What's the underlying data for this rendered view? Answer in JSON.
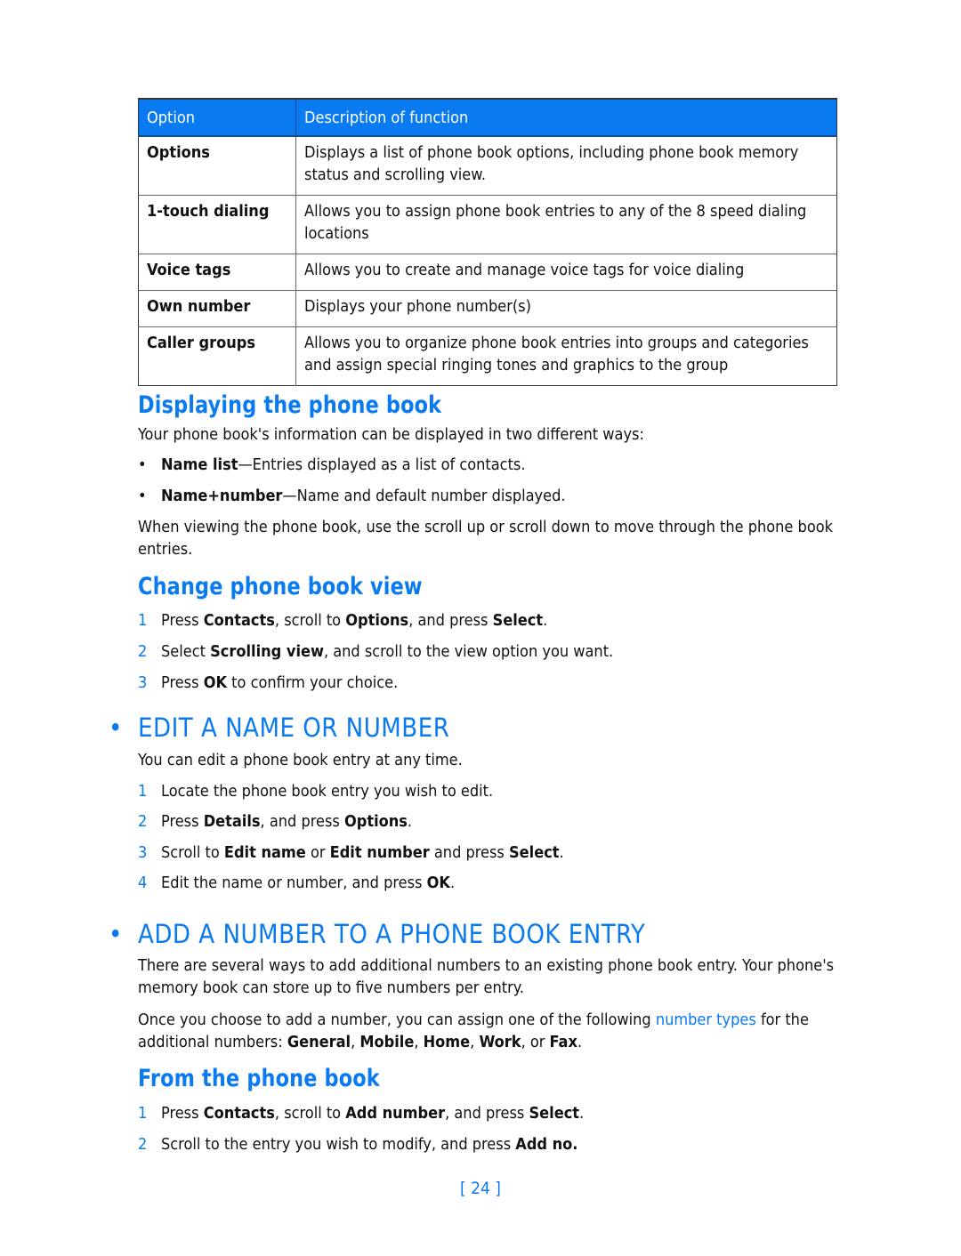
{
  "table": {
    "headers": [
      "Option",
      "Description of function"
    ],
    "rows": [
      {
        "option": "Options",
        "description": "Displays a list of phone book options, including phone book memory status and scrolling view."
      },
      {
        "option": "1-touch dialing",
        "description": "Allows you to assign phone book entries to any of the 8 speed dialing locations"
      },
      {
        "option": "Voice tags",
        "description": "Allows you to create and manage voice tags for voice dialing"
      },
      {
        "option": "Own number",
        "description": "Displays your phone number(s)"
      },
      {
        "option": "Caller groups",
        "description": "Allows you to organize phone book entries into groups and categories and assign special ringing tones and graphics to the group"
      }
    ]
  },
  "displaying": {
    "title": "Displaying the phone book",
    "intro": "Your phone book's information can be displayed in two different ways:",
    "bullets": [
      {
        "term": "Name list",
        "text": "—Entries displayed as a list of contacts."
      },
      {
        "term": "Name+number",
        "text": "—Name and default number displayed."
      }
    ],
    "bullet_glyph": "•",
    "note": "When viewing the phone book, use the scroll up or scroll down to move through the phone book entries."
  },
  "change_view": {
    "title": "Change phone book view",
    "steps": [
      {
        "num": "1",
        "parts": [
          "Press ",
          "Contacts",
          ", scroll to ",
          "Options",
          ", and press ",
          "Select",
          "."
        ]
      },
      {
        "num": "2",
        "parts": [
          "Select ",
          "Scrolling view",
          ", and scroll to the view option you want.",
          "",
          "",
          "",
          ""
        ]
      },
      {
        "num": "3",
        "parts": [
          "Press ",
          "OK",
          " to confirm your choice.",
          "",
          "",
          "",
          ""
        ]
      }
    ]
  },
  "edit": {
    "title": "EDIT A NAME OR NUMBER",
    "bullet_glyph": "•",
    "intro": "You can edit a phone book entry at any time.",
    "steps": [
      {
        "num": "1",
        "parts": [
          "Locate the phone book entry you wish to edit.",
          "",
          "",
          "",
          "",
          "",
          ""
        ]
      },
      {
        "num": "2",
        "parts": [
          "Press ",
          "Details",
          ", and press ",
          "Options",
          ".",
          "",
          ""
        ]
      },
      {
        "num": "3",
        "parts": [
          "Scroll to ",
          "Edit name",
          " or ",
          "Edit number",
          " and press ",
          "Select",
          "."
        ]
      },
      {
        "num": "4",
        "parts": [
          "Edit the name or number, and press ",
          "OK",
          ".",
          "",
          "",
          "",
          ""
        ]
      }
    ]
  },
  "add_number": {
    "title": "ADD A NUMBER TO A PHONE BOOK ENTRY",
    "bullet_glyph": "•",
    "para1": "There are several ways to add additional numbers to an existing phone book entry. Your phone's memory book can store up to five numbers per entry.",
    "para2_pre": "Once you choose to add a number, you can assign one of the following ",
    "para2_link": "number types",
    "para2_mid": " for the additional numbers: ",
    "types": [
      "General",
      "Mobile",
      "Home",
      "Work",
      "Fax"
    ],
    "sep1": ", ",
    "sep_or": ", or ",
    "end": "."
  },
  "from_phone_book": {
    "title": "From the phone book",
    "steps": [
      {
        "num": "1",
        "parts": [
          "Press ",
          "Contacts",
          ", scroll to ",
          "Add number",
          ", and press ",
          "Select",
          "."
        ]
      },
      {
        "num": "2",
        "parts": [
          "Scroll to the entry you wish to modify, and press ",
          "Add no.",
          "",
          "",
          "",
          "",
          ""
        ]
      }
    ]
  },
  "footer": {
    "page_number": "[ 24 ]"
  },
  "colors": {
    "accent": "#0a7af0",
    "text": "#111111"
  }
}
